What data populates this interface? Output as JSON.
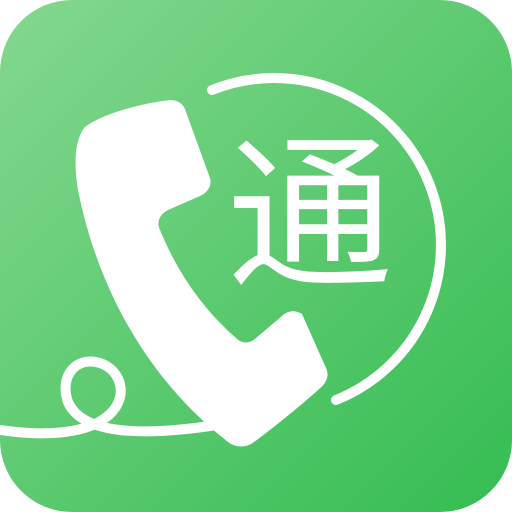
{
  "app_icon": {
    "glyph": "通",
    "colors": {
      "gradient_start": "#84D88F",
      "gradient_end": "#35BC52",
      "foreground": "#FFFFFF"
    },
    "icons": [
      "phone-handset-icon",
      "cord-loop-icon"
    ]
  }
}
